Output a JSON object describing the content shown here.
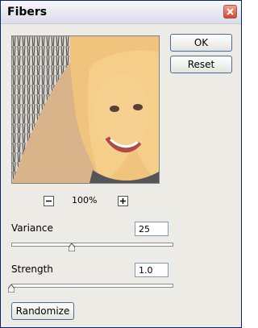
{
  "window": {
    "title": "Fibers"
  },
  "buttons": {
    "ok": "OK",
    "reset": "Reset",
    "randomize": "Randomize"
  },
  "zoom": {
    "label": "100%"
  },
  "variance": {
    "label": "Variance",
    "value": "25",
    "slider_fraction": 0.4
  },
  "strength": {
    "label": "Strength",
    "value": "1.0",
    "slider_fraction": 0.0
  },
  "icons": {
    "close": "close-icon",
    "zoom_out": "minus-icon",
    "zoom_in": "plus-icon"
  }
}
